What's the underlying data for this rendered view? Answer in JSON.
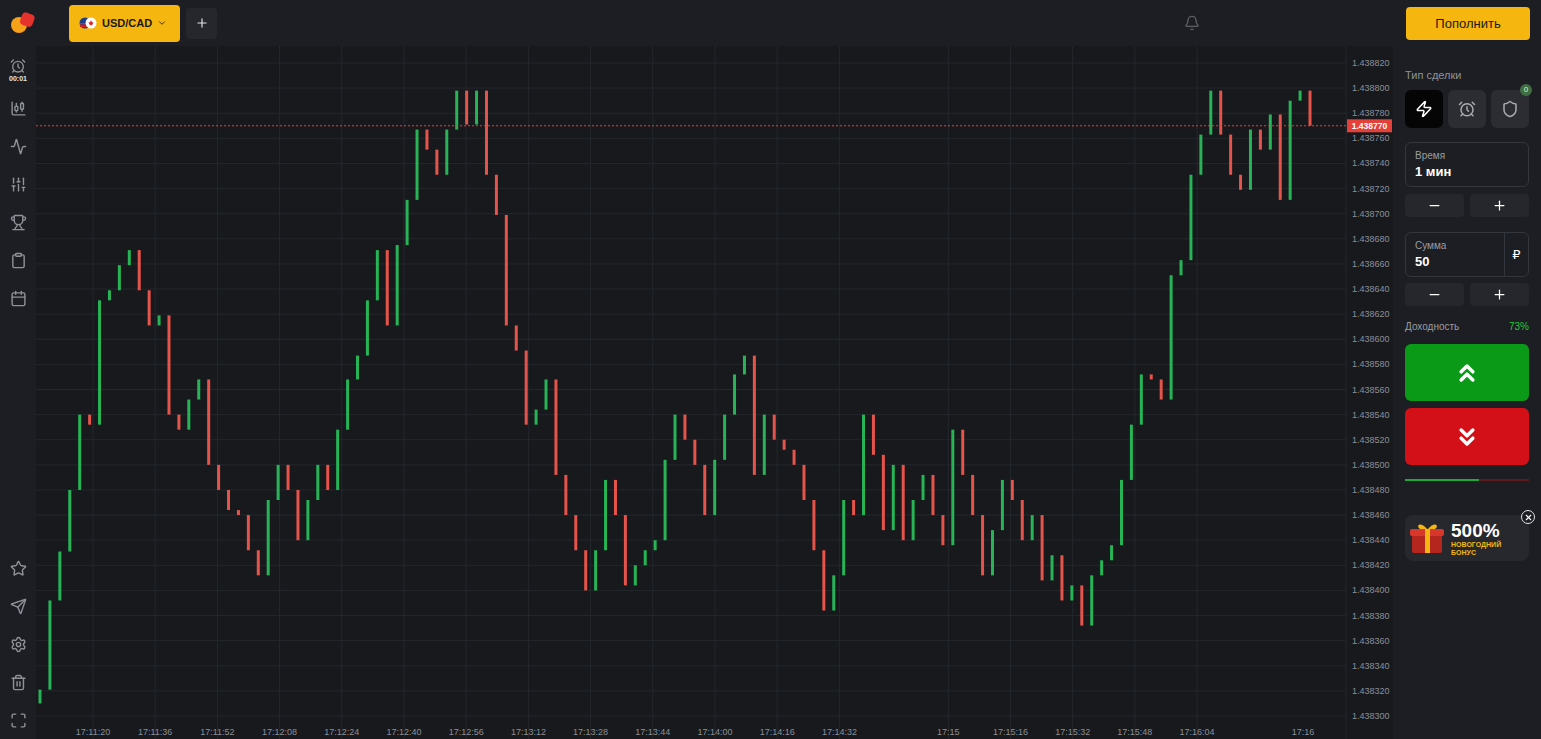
{
  "topbar": {
    "asset": {
      "label": "USD/CAD",
      "selected": true
    },
    "deposit_button": "Пополнить"
  },
  "sidebar": {
    "timer": "00:01"
  },
  "chart": {
    "price_ticks": [
      "1.438820",
      "1.438800",
      "1.438780",
      "1.438760",
      "1.438740",
      "1.438720",
      "1.438700",
      "1.438680",
      "1.438660",
      "1.438640",
      "1.438620",
      "1.438600",
      "1.438580",
      "1.438560",
      "1.438540",
      "1.438520",
      "1.438500",
      "1.438480",
      "1.438460",
      "1.438440",
      "1.438420",
      "1.438400",
      "1.438380",
      "1.438360",
      "1.438340",
      "1.438320",
      "1.438300"
    ],
    "time_ticks": [
      "17:11:20",
      "17:11:36",
      "17:11:52",
      "17:12:08",
      "17:12:24",
      "17:12:40",
      "17:12:56",
      "17:13:12",
      "17:13:28",
      "17:13:44",
      "17:14:00",
      "17:14:16",
      "17:14:32",
      "17:15",
      "17:15:16",
      "17:15:32",
      "17:15:48",
      "17:16:04"
    ],
    "current_time": "17:16",
    "current_price": "1.438770",
    "first_open": 1.43831,
    "closes": [
      1.438321,
      1.438392,
      1.438431,
      1.43848,
      1.43854,
      1.438532,
      1.438631,
      1.438639,
      1.438659,
      1.438671,
      1.438639,
      1.438611,
      1.438619,
      1.43854,
      1.438528,
      1.438552,
      1.438568,
      1.4385,
      1.43848,
      1.438464,
      1.43846,
      1.438432,
      1.438412,
      1.438472,
      1.4385,
      1.43848,
      1.43844,
      1.438472,
      1.4385,
      1.43848,
      1.438528,
      1.438568,
      1.438587,
      1.438631,
      1.438671,
      1.438611,
      1.438675,
      1.438711,
      1.438767,
      1.438751,
      1.438731,
      1.438767,
      1.438798,
      1.438771,
      1.438798,
      1.438731,
      1.438699,
      1.438611,
      1.438591,
      1.438532,
      1.438544,
      1.438568,
      1.438492,
      1.43846,
      1.438432,
      1.4384,
      1.438432,
      1.438488,
      1.43846,
      1.438404,
      1.43842,
      1.438432,
      1.43844,
      1.438504,
      1.43854,
      1.43852,
      1.4385,
      1.43846,
      1.438504,
      1.43854,
      1.438572,
      1.438587,
      1.438492,
      1.43854,
      1.43852,
      1.438512,
      1.4385,
      1.438472,
      1.438432,
      1.438384,
      1.438412,
      1.438472,
      1.43846,
      1.43854,
      1.438508,
      1.438448,
      1.4385,
      1.43844,
      1.438472,
      1.438492,
      1.43846,
      1.438436,
      1.438528,
      1.438492,
      1.43846,
      1.438412,
      1.438448,
      1.438488,
      1.438472,
      1.43844,
      1.43846,
      1.438408,
      1.438428,
      1.438392,
      1.438404,
      1.438372,
      1.438412,
      1.438424,
      1.438436,
      1.438488,
      1.438532,
      1.438572,
      1.438568,
      1.438552,
      1.438651,
      1.438663,
      1.438731,
      1.438763,
      1.438798,
      1.438763,
      1.438731,
      1.438719,
      1.438767,
      1.438751,
      1.438779,
      1.438711,
      1.43879,
      1.438798,
      1.43877
    ]
  },
  "trade_panel": {
    "title": "Тип сделки",
    "types": [
      {
        "kind": "turbo",
        "selected": true
      },
      {
        "kind": "timer",
        "selected": false
      },
      {
        "kind": "insured",
        "selected": false,
        "badge": "0"
      }
    ],
    "time": {
      "label": "Время",
      "value": "1 мин"
    },
    "amount": {
      "label": "Сумма",
      "value": "50",
      "currency": "₽"
    },
    "payout": {
      "label": "Доходность",
      "value": "73%"
    },
    "sentiment": {
      "level": 0.6
    },
    "promo": {
      "value": "500%",
      "caption": [
        "НОВОГОДНИЙ",
        "БОНУС"
      ]
    }
  }
}
